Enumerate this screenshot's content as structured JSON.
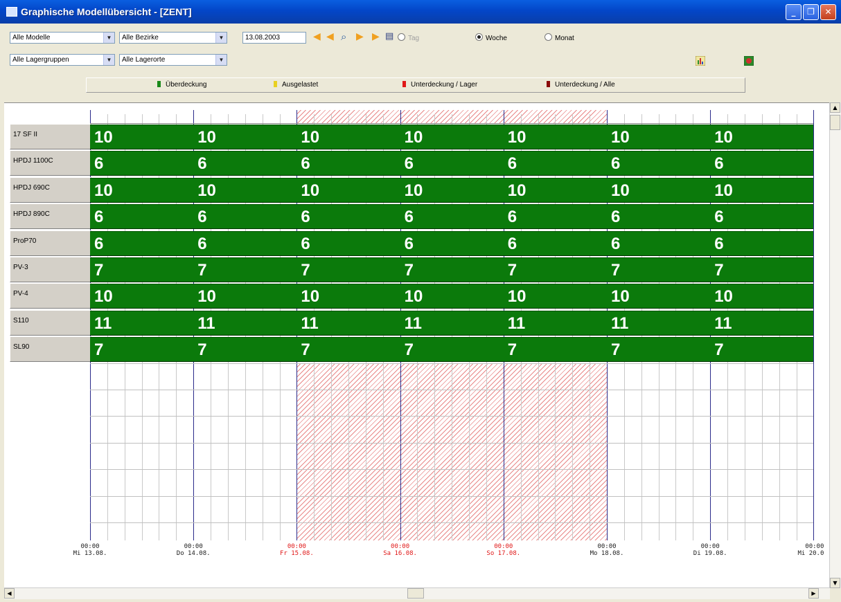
{
  "window": {
    "title": "Graphische Modellübersicht - [ZENT]"
  },
  "filters": {
    "modelle": "Alle Modelle",
    "bezirke": "Alle Bezirke",
    "lagergruppen": "Alle Lagergruppen",
    "lagerorte": "Alle Lagerorte"
  },
  "date": "13.08.2003",
  "view": {
    "options": [
      {
        "label": "Tag",
        "selected": false,
        "enabled": false
      },
      {
        "label": "Woche",
        "selected": true,
        "enabled": true
      },
      {
        "label": "Monat",
        "selected": false,
        "enabled": true
      }
    ]
  },
  "legend": [
    {
      "label": "Überdeckung",
      "color": "#1a8a1a"
    },
    {
      "label": "Ausgelastet",
      "color": "#e8d020"
    },
    {
      "label": "Unterdeckung / Lager",
      "color": "#e01818"
    },
    {
      "label": "Unterdeckung / Alle",
      "color": "#8a0a0a"
    }
  ],
  "chart_data": {
    "type": "heatmap",
    "x": [
      "Mi 13.08.",
      "Do 14.08.",
      "Fr 15.08.",
      "Sa 16.08.",
      "So 17.08.",
      "Mo 18.08.",
      "Di 19.08."
    ],
    "axis_ticks": [
      {
        "time": "00:00",
        "date": "Mi 13.08.",
        "holiday": false
      },
      {
        "time": "00:00",
        "date": "Do 14.08.",
        "holiday": false
      },
      {
        "time": "00:00",
        "date": "Fr 15.08.",
        "holiday": true
      },
      {
        "time": "00:00",
        "date": "Sa 16.08.",
        "holiday": true
      },
      {
        "time": "00:00",
        "date": "So 17.08.",
        "holiday": true
      },
      {
        "time": "00:00",
        "date": "Mo 18.08.",
        "holiday": false
      },
      {
        "time": "00:00",
        "date": "Di 19.08.",
        "holiday": false
      },
      {
        "time": "00:00",
        "date": "Mi 20.0",
        "holiday": false
      }
    ],
    "rows": [
      {
        "model": "17 SF II",
        "values": [
          10,
          10,
          10,
          10,
          10,
          10,
          10
        ]
      },
      {
        "model": "HPDJ 1100C",
        "values": [
          6,
          6,
          6,
          6,
          6,
          6,
          6
        ]
      },
      {
        "model": "HPDJ 690C",
        "values": [
          10,
          10,
          10,
          10,
          10,
          10,
          10
        ]
      },
      {
        "model": "HPDJ 890C",
        "values": [
          6,
          6,
          6,
          6,
          6,
          6,
          6
        ]
      },
      {
        "model": "ProP70",
        "values": [
          6,
          6,
          6,
          6,
          6,
          6,
          6
        ]
      },
      {
        "model": "PV-3",
        "values": [
          7,
          7,
          7,
          7,
          7,
          7,
          7
        ]
      },
      {
        "model": "PV-4",
        "values": [
          10,
          10,
          10,
          10,
          10,
          10,
          10
        ]
      },
      {
        "model": "S110",
        "values": [
          11,
          11,
          11,
          11,
          11,
          11,
          11
        ]
      },
      {
        "model": "SL90",
        "values": [
          7,
          7,
          7,
          7,
          7,
          7,
          7
        ]
      }
    ],
    "status": "Überdeckung",
    "status_color": "#0b7a0b",
    "holiday_color": "#e01818"
  }
}
